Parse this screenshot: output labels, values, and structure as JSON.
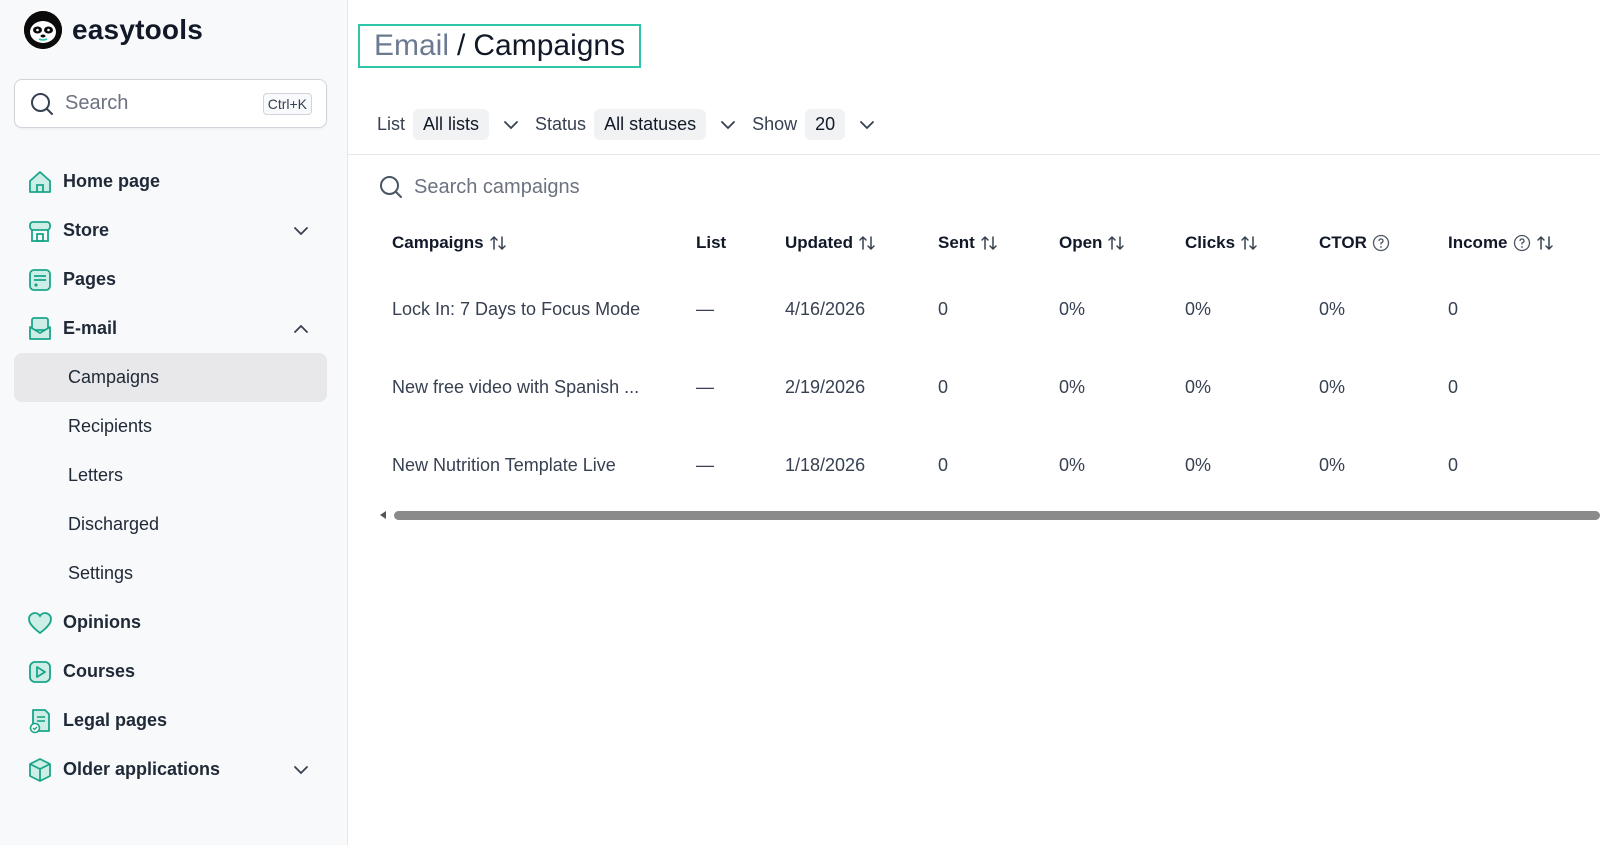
{
  "app": {
    "name": "easytools"
  },
  "search": {
    "placeholder": "Search",
    "shortcut": "Ctrl+K"
  },
  "sidebar": {
    "items": [
      {
        "label": "Home page",
        "icon": "home-icon"
      },
      {
        "label": "Store",
        "icon": "store-icon",
        "expandable": true
      },
      {
        "label": "Pages",
        "icon": "pages-icon"
      },
      {
        "label": "E-mail",
        "icon": "mail-icon",
        "expanded": true,
        "children": [
          "Campaigns",
          "Recipients",
          "Letters",
          "Discharged",
          "Settings"
        ]
      },
      {
        "label": "Opinions",
        "icon": "heart-icon"
      },
      {
        "label": "Courses",
        "icon": "play-icon"
      },
      {
        "label": "Legal pages",
        "icon": "legal-icon"
      },
      {
        "label": "Older applications",
        "icon": "box-icon",
        "expandable": true
      }
    ],
    "active_child": "Campaigns"
  },
  "breadcrumb": {
    "parent": "Email",
    "separator": "/",
    "current": "Campaigns"
  },
  "filters": {
    "list": {
      "label": "List",
      "value": "All lists"
    },
    "status": {
      "label": "Status",
      "value": "All statuses"
    },
    "show": {
      "label": "Show",
      "value": "20"
    }
  },
  "table_search": {
    "placeholder": "Search campaigns"
  },
  "table": {
    "columns": [
      "Campaigns",
      "List",
      "Updated",
      "Sent",
      "Open",
      "Clicks",
      "CTOR",
      "Income"
    ],
    "rows": [
      [
        "Lock In: 7 Days to Focus Mode",
        "—",
        "4/16/2026",
        "0",
        "0%",
        "0%",
        "0%",
        "0"
      ],
      [
        "New free video with Spanish ...",
        "—",
        "2/19/2026",
        "0",
        "0%",
        "0%",
        "0%",
        "0"
      ],
      [
        "New Nutrition Template Live",
        "—",
        "1/18/2026",
        "0",
        "0%",
        "0%",
        "0%",
        "0"
      ]
    ]
  },
  "colors": {
    "accent": "#2dc6a8",
    "icon_teal": "#1aa58a",
    "active_bg": "#e8e8ea"
  }
}
